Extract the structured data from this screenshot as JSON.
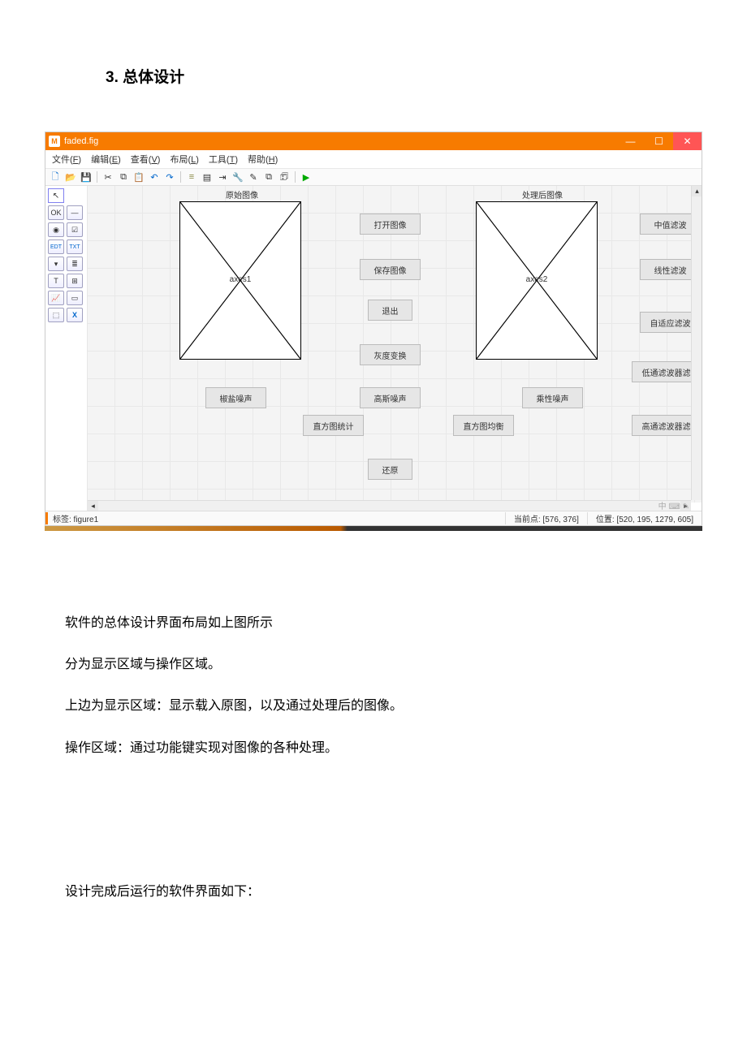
{
  "heading": "3. 总体设计",
  "window": {
    "title": "faded.fig",
    "menus": {
      "file": {
        "full": "文件(F)",
        "text": "文件(",
        "u": "F",
        "tail": ")"
      },
      "edit": {
        "full": "编辑(E)",
        "text": "编辑(",
        "u": "E",
        "tail": ")"
      },
      "view": {
        "full": "查看(V)",
        "text": "查看(",
        "u": "V",
        "tail": ")"
      },
      "layout": {
        "full": "布局(L)",
        "text": "布局(",
        "u": "L",
        "tail": ")"
      },
      "tools": {
        "full": "工具(T)",
        "text": "工具(",
        "u": "T",
        "tail": ")"
      },
      "help": {
        "full": "帮助(H)",
        "text": "帮助(",
        "u": "H",
        "tail": ")"
      }
    },
    "toolbar": {
      "new": "🗋",
      "open": "📂",
      "save": "💾",
      "cut": "✂",
      "copy": "⧉",
      "paste": "📋",
      "undo": "↶",
      "redo": "↷",
      "align": "≡",
      "menuEd": "▤",
      "tabEd": "⇥",
      "tbEd": "🔧",
      "editor": "✎",
      "propInsp": "⧉",
      "objBrowser": "🗊",
      "run": "▶"
    },
    "palette": {
      "pointer": "↖",
      "push": "OK",
      "slider": "—",
      "radio": "◉",
      "check": "☑",
      "edit": "EDT",
      "text": "TXT",
      "popup": "▾",
      "list": "≣",
      "toggle": "T",
      "table": "⊞",
      "axes": "📈",
      "panel": "▭",
      "bgroup": "⬚",
      "activex": "X"
    },
    "labels": {
      "axes1_title": "原始图像",
      "axes2_title": "处理后图像",
      "axes1": "axes1",
      "axes2": "axes2"
    },
    "buttons": {
      "open_image": "打开图像",
      "save_image": "保存图像",
      "exit": "退出",
      "gray": "灰度变换",
      "saltpepper": "椒盐噪声",
      "gauss_noise": "高斯噪声",
      "mult_noise": "乘性噪声",
      "hist_stat": "直方图统计",
      "hist_eq": "直方图均衡",
      "restore": "还原",
      "median": "中值滤波",
      "linear": "线性滤波",
      "adaptive": "自适应滤波",
      "lowpass": "低通滤波器滤波",
      "highpass": "高通滤波器滤波"
    },
    "status": {
      "tag_label": "标签: figure1",
      "current_point": "当前点: [576, 376]",
      "position": "位置: [520, 195, 1279, 605]",
      "ime": "中 ⌨ ✎"
    },
    "win_controls": {
      "min": "—",
      "max": "☐",
      "close": "✕"
    }
  },
  "body": {
    "p1": "软件的总体设计界面布局如上图所示",
    "p2": "分为显示区域与操作区域。",
    "p3": "上边为显示区域：显示载入原图，以及通过处理后的图像。",
    "p4": "操作区域：通过功能键实现对图像的各种处理。",
    "p5": "设计完成后运行的软件界面如下："
  }
}
